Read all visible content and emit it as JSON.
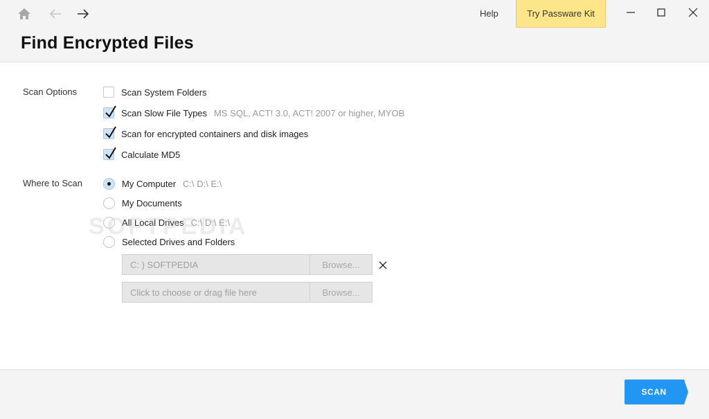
{
  "header": {
    "title": "Find Encrypted Files",
    "help_label": "Help",
    "try_label": "Try Passware Kit",
    "try_color": "#fde68a"
  },
  "nav": {
    "home_icon": "home-icon",
    "back_icon": "arrow-left-icon",
    "forward_icon": "arrow-right-icon"
  },
  "window_controls": [
    "minimize-icon",
    "maximize-icon",
    "close-icon"
  ],
  "scan_options": {
    "label": "Scan Options",
    "items": [
      {
        "label": "Scan System Folders",
        "checked": false,
        "hint": ""
      },
      {
        "label": "Scan Slow File Types",
        "checked": true,
        "hint": "MS SQL, ACT! 3.0, ACT! 2007 or higher, MYOB"
      },
      {
        "label": "Scan for encrypted containers and disk images",
        "checked": true,
        "hint": ""
      },
      {
        "label": "Calculate MD5",
        "checked": true,
        "hint": ""
      }
    ]
  },
  "where_to_scan": {
    "label": "Where to Scan",
    "options": [
      {
        "label": "My Computer",
        "selected": true,
        "hint": "C:\\ D:\\ E:\\"
      },
      {
        "label": "My Documents",
        "selected": false,
        "hint": ""
      },
      {
        "label": "All Local Drives",
        "selected": false,
        "hint": "C:\\ D:\\ E:\\"
      },
      {
        "label": "Selected Drives and Folders",
        "selected": false,
        "hint": ""
      }
    ],
    "paths": [
      {
        "value": "C: ) SOFTPEDIA",
        "browse_label": "Browse..."
      },
      {
        "value": "",
        "placeholder": "Click to choose or drag file here",
        "browse_label": "Browse..."
      }
    ]
  },
  "watermark": "SOFTPEDIA",
  "footer": {
    "scan_label": "SCAN",
    "scan_color": "#2196f3"
  }
}
